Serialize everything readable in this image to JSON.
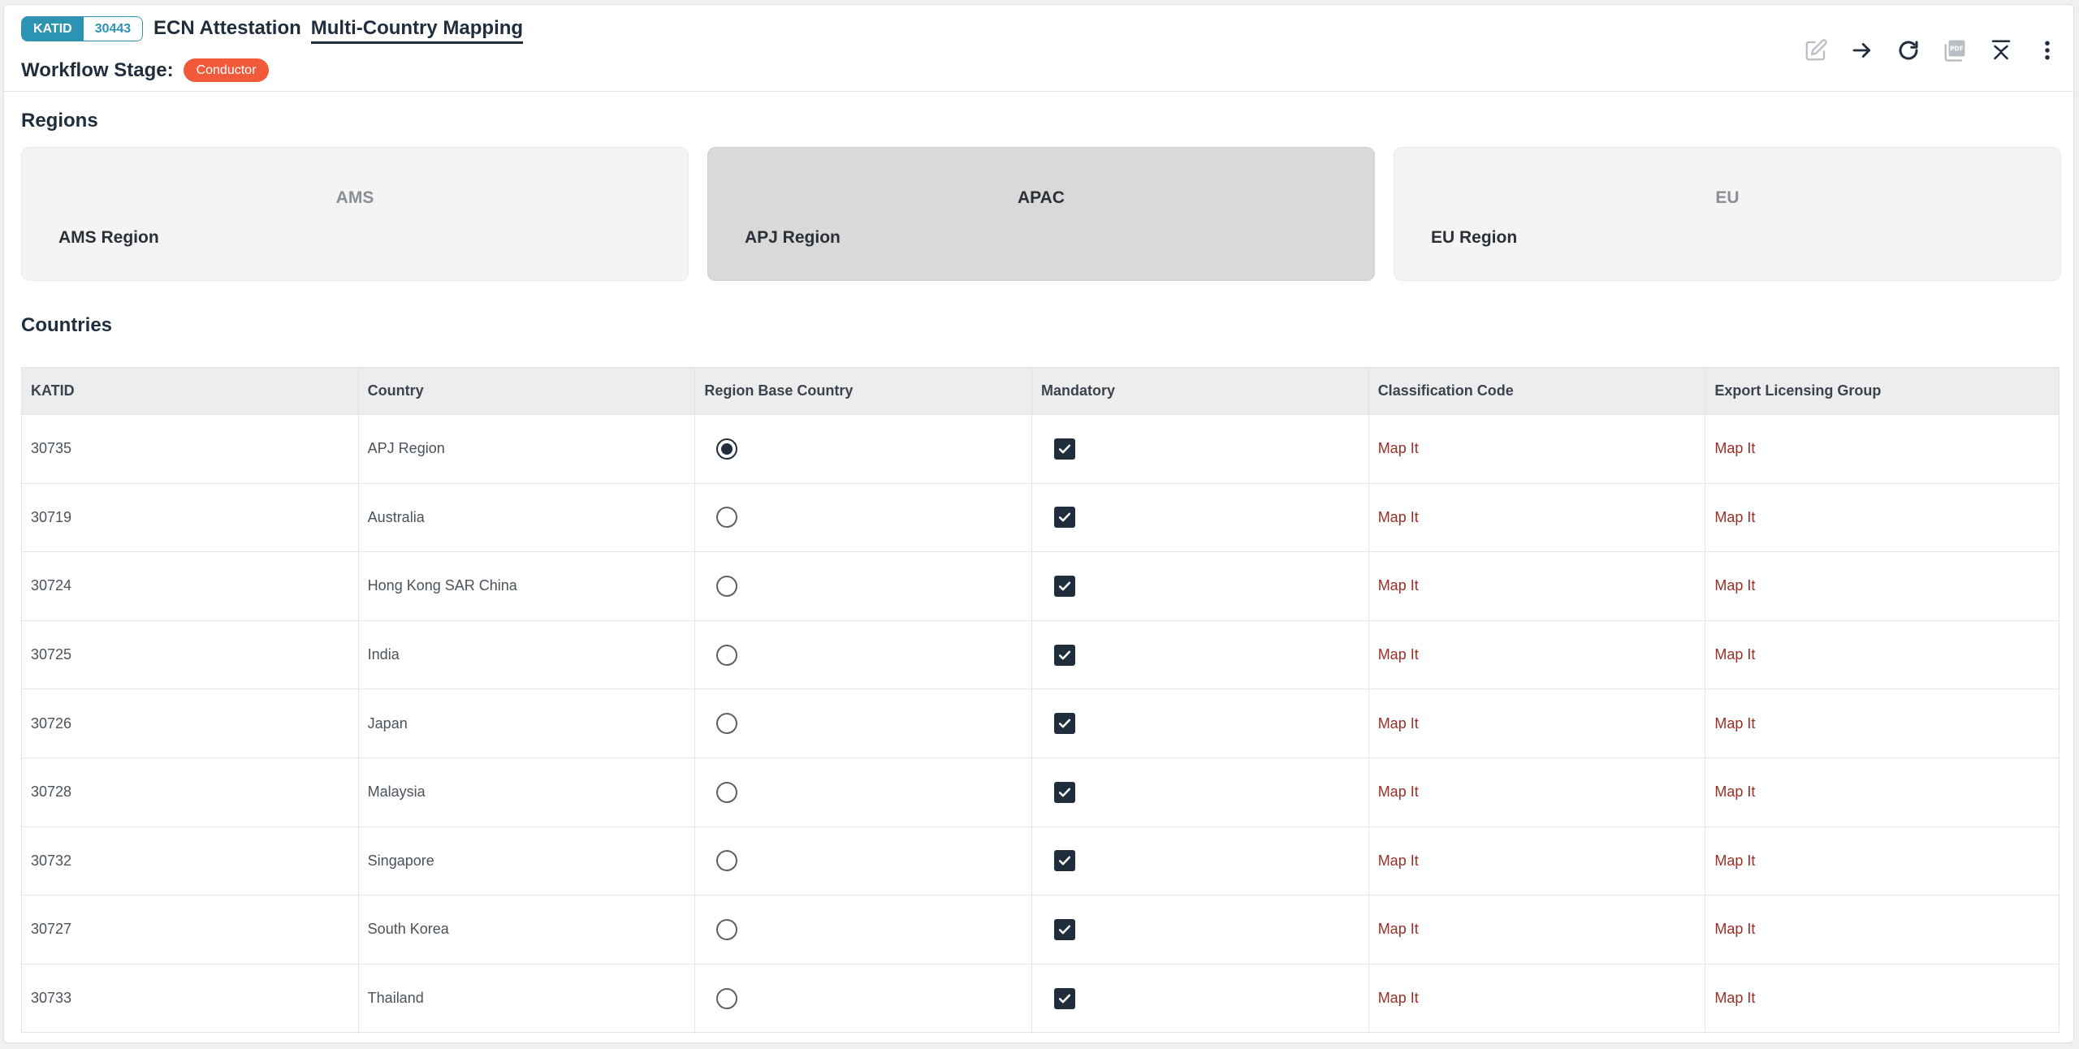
{
  "header": {
    "id_key": "KATID",
    "id_value": "30443",
    "title": "ECN Attestation",
    "subtitle": "Multi-Country Mapping",
    "stage_label": "Workflow Stage:",
    "stage_value": "Conductor"
  },
  "toolbar": {
    "icons": [
      "edit-icon",
      "arrow-right-icon",
      "refresh-icon",
      "pdf-icon",
      "collapse-icon",
      "more-vertical-icon"
    ]
  },
  "regions": {
    "title": "Regions",
    "items": [
      {
        "code": "AMS",
        "name": "AMS Region",
        "selected": false
      },
      {
        "code": "APAC",
        "name": "APJ Region",
        "selected": true
      },
      {
        "code": "EU",
        "name": "EU Region",
        "selected": false
      }
    ]
  },
  "countries": {
    "title": "Countries",
    "columns": [
      "KATID",
      "Country",
      "Region Base Country",
      "Mandatory",
      "Classification Code",
      "Export Licensing Group"
    ],
    "link_label": "Map It",
    "rows": [
      {
        "katid": "30735",
        "country": "APJ Region",
        "base": true,
        "mandatory": true
      },
      {
        "katid": "30719",
        "country": "Australia",
        "base": false,
        "mandatory": true
      },
      {
        "katid": "30724",
        "country": "Hong Kong SAR China",
        "base": false,
        "mandatory": true
      },
      {
        "katid": "30725",
        "country": "India",
        "base": false,
        "mandatory": true
      },
      {
        "katid": "30726",
        "country": "Japan",
        "base": false,
        "mandatory": true
      },
      {
        "katid": "30728",
        "country": "Malaysia",
        "base": false,
        "mandatory": true
      },
      {
        "katid": "30732",
        "country": "Singapore",
        "base": false,
        "mandatory": true
      },
      {
        "katid": "30727",
        "country": "South Korea",
        "base": false,
        "mandatory": true
      },
      {
        "katid": "30733",
        "country": "Thailand",
        "base": false,
        "mandatory": true
      }
    ]
  },
  "colors": {
    "accent": "#2c93b3",
    "badge": "#f05a3a",
    "dark": "#1f2d3d",
    "link": "#9a2f26"
  }
}
